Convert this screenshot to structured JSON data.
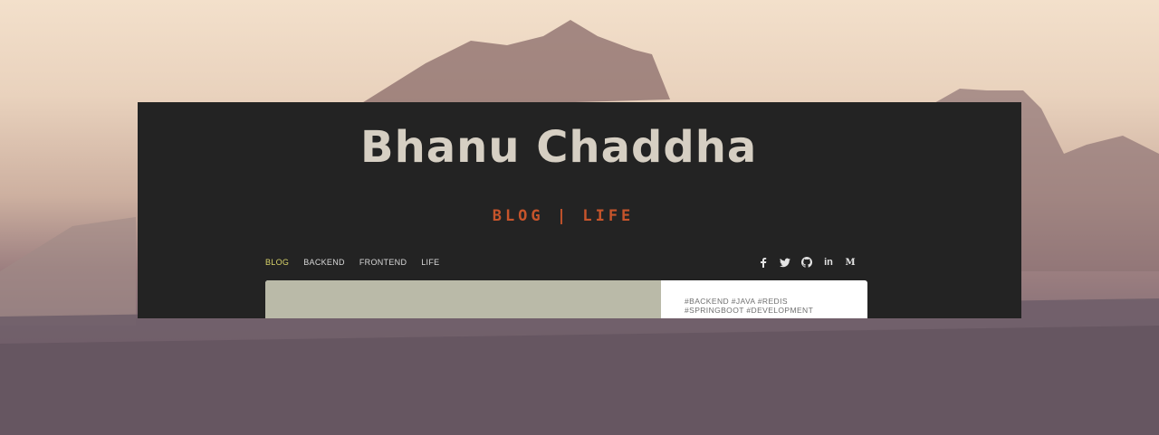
{
  "site": {
    "title": "Bhanu Chaddha",
    "tagline": "BLOG | LIFE"
  },
  "nav": {
    "items": [
      {
        "label": "BLOG",
        "active": true
      },
      {
        "label": "BACKEND",
        "active": false
      },
      {
        "label": "FRONTEND",
        "active": false
      },
      {
        "label": "LIFE",
        "active": false
      }
    ]
  },
  "social": {
    "icons": [
      "facebook-icon",
      "twitter-icon",
      "github-icon",
      "linkedin-icon",
      "medium-icon"
    ],
    "linkedin_text": "in",
    "medium_text": "M"
  },
  "post": {
    "tags": "#BACKEND #JAVA #REDIS #SPRINGBOOT #DEVELOPMENT"
  },
  "colors": {
    "panel": "#232323",
    "title": "#d6cfc3",
    "tagline": "#c6542b",
    "nav_active": "#d8d36a",
    "card_image": "#babaa8"
  }
}
